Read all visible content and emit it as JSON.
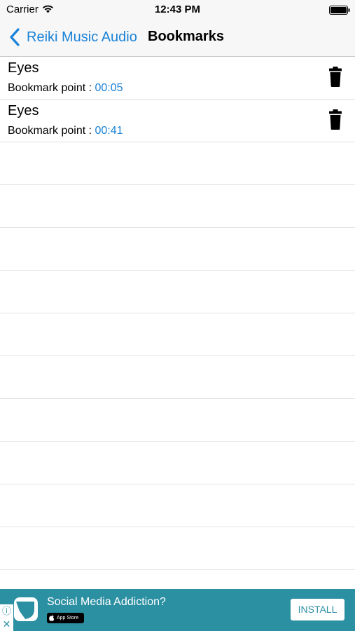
{
  "status_bar": {
    "carrier": "Carrier",
    "time": "12:43 PM"
  },
  "nav": {
    "back_label": "Reiki Music Audio",
    "title": "Bookmarks"
  },
  "bookmarks": [
    {
      "title": "Eyes",
      "label": "Bookmark point : ",
      "time": "00:05"
    },
    {
      "title": "Eyes",
      "label": "Bookmark point : ",
      "time": "00:41"
    }
  ],
  "ad": {
    "title": "Social Media Addiction?",
    "store_badge": "App Store",
    "install_label": "INSTALL",
    "info_glyph": "ⓘ",
    "close_glyph": "✕"
  },
  "colors": {
    "accent": "#1a82d7",
    "ad_background": "#2c90a3"
  },
  "icons": {
    "back": "chevron-left-icon",
    "delete": "trash-icon",
    "wifi": "wifi-icon",
    "battery": "battery-icon"
  }
}
